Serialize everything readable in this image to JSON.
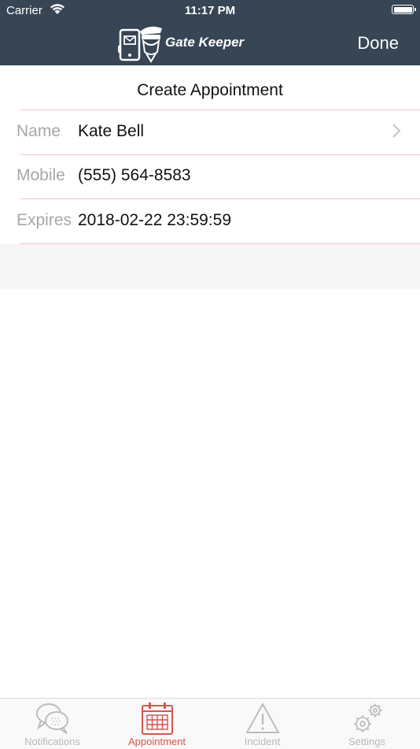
{
  "status_bar": {
    "carrier": "Carrier",
    "time": "11:17 PM"
  },
  "nav": {
    "logo_text": "Gate Keeper",
    "done_label": "Done",
    "background": "#374555"
  },
  "form": {
    "title": "Create Appointment",
    "fields": [
      {
        "label": "Name",
        "value": "Kate Bell",
        "has_chevron": true
      },
      {
        "label": "Mobile",
        "value": "(555) 564-8583",
        "has_chevron": false
      },
      {
        "label": "Expires",
        "value": "2018-02-22 23:59:59",
        "has_chevron": false
      }
    ]
  },
  "tabbar": {
    "active_color": "#d9534f",
    "tabs": [
      {
        "label": "Notifications",
        "icon": "chat-bubbles-icon",
        "active": false
      },
      {
        "label": "Appointment",
        "icon": "calendar-icon",
        "active": true
      },
      {
        "label": "Incident",
        "icon": "warning-triangle-icon",
        "active": false
      },
      {
        "label": "Settings",
        "icon": "gears-icon",
        "active": false
      }
    ]
  }
}
